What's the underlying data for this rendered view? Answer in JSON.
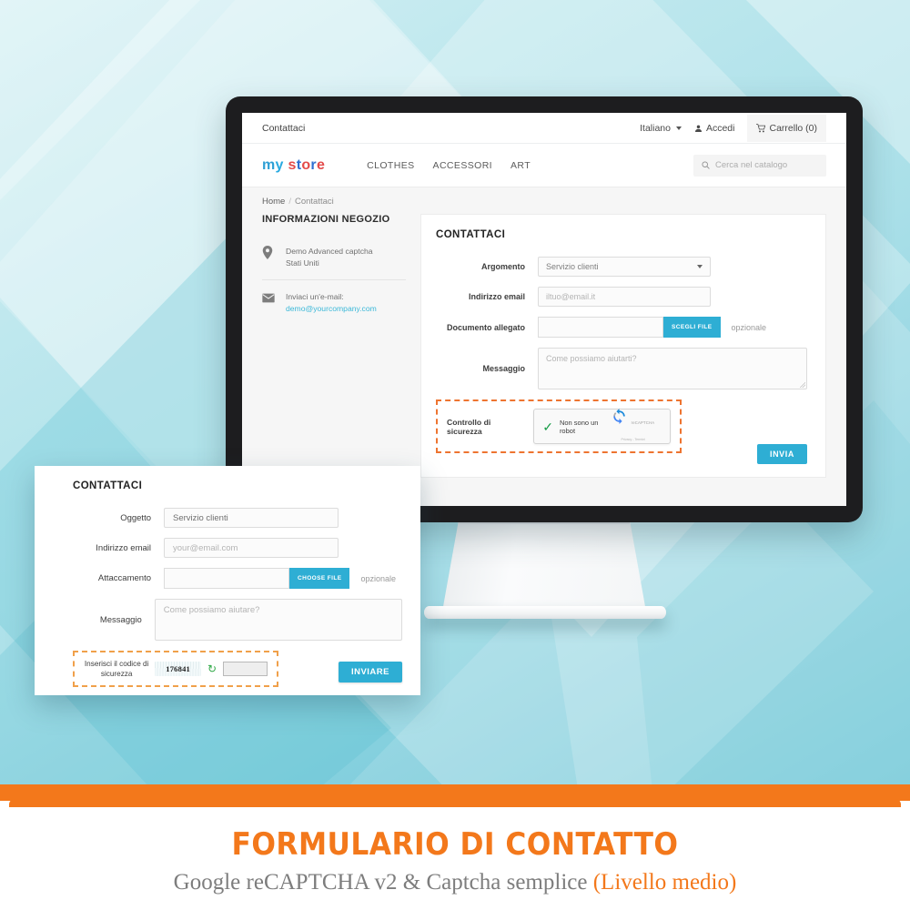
{
  "colors": {
    "accent": "#2eaed4",
    "orange": "#f3781b",
    "dashed_main": "#ee7430",
    "dashed_front": "#f0a04a",
    "link": "#3bb8d8"
  },
  "browser": {
    "top_nav": {
      "page_label": "Contattaci",
      "language": "Italiano",
      "login": "Accedi",
      "cart": "Carrello (0)"
    },
    "header": {
      "logo": "my store",
      "menu": [
        "CLOTHES",
        "ACCESSORI",
        "ART"
      ],
      "search_placeholder": "Cerca nel catalogo"
    },
    "breadcrumb": {
      "home": "Home",
      "separator": "/",
      "current": "Contattaci"
    },
    "sidebar": {
      "title": "INFORMAZIONI NEGOZIO",
      "address_line1": "Demo Advanced captcha",
      "address_line2": "Stati Uniti",
      "email_label": "Inviaci un'e-mail:",
      "email": "demo@yourcompany.com"
    },
    "form": {
      "title": "CONTATTACI",
      "subject_label": "Argomento",
      "subject_value": "Servizio clienti",
      "email_label": "Indirizzo email",
      "email_placeholder": "iltuo@email.it",
      "attachment_label": "Documento allegato",
      "attachment_value": "",
      "choose_file": "SCEGLI FILE",
      "optional": "opzionale",
      "message_label": "Messaggio",
      "message_placeholder": "Come possiamo aiutarti?",
      "security_label": "Controllo di sicurezza",
      "recaptcha_text": "Non sono un robot",
      "recaptcha_brand": "reCAPTCHA",
      "recaptcha_links": "Privacy - Termini",
      "submit": "INVIA"
    }
  },
  "front_card": {
    "title": "CONTATTACI",
    "subject_label": "Oggetto",
    "subject_value": "Servizio clienti",
    "email_label": "Indirizzo email",
    "email_placeholder": "your@email.com",
    "attachment_label": "Attaccamento",
    "attachment_value": "",
    "choose_file": "CHOOSE FILE",
    "optional": "opzionale",
    "message_label": "Messaggio",
    "message_placeholder": "Come possiamo aiutare?",
    "captcha_label": "Inserisci il codice di sicurezza",
    "captcha_code": "176841",
    "captcha_input_value": "",
    "submit": "INVIARE"
  },
  "banner": {
    "title": "FORMULARIO DI CONTATTO",
    "subtitle_plain": "Google reCAPTCHA v2 & Captcha semplice ",
    "subtitle_orange": "(Livello medio)"
  }
}
